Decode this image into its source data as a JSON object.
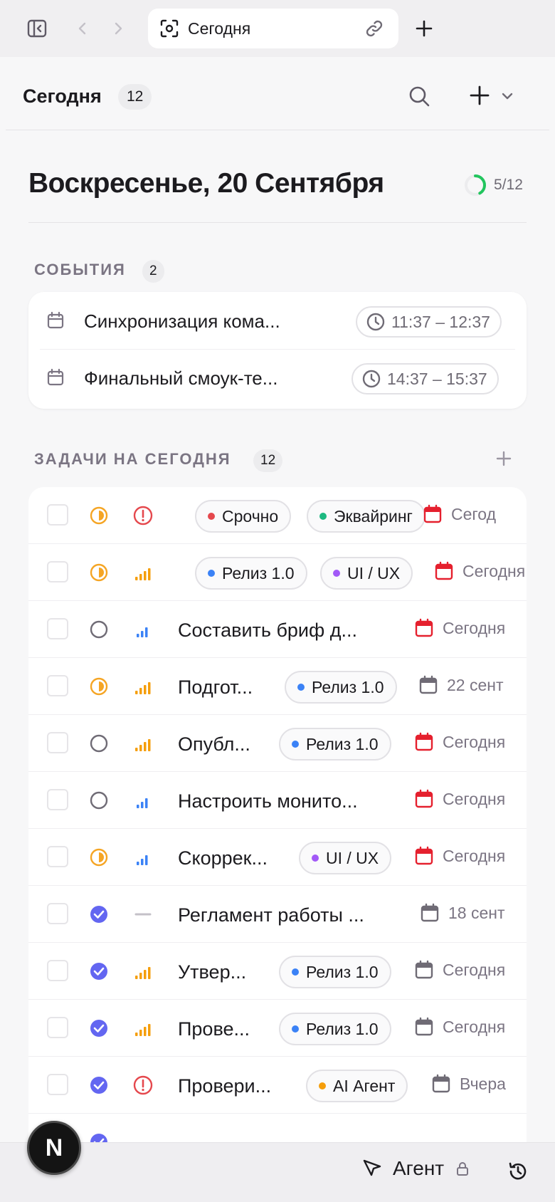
{
  "browser": {
    "tab_title": "Сегодня",
    "icons": [
      "sidebar-toggle-icon",
      "back-icon",
      "forward-icon",
      "focus-icon",
      "link-icon",
      "new-tab-icon"
    ]
  },
  "header": {
    "title": "Сегодня",
    "count": "12"
  },
  "date_heading": "Воскресенье, 20 Сентября",
  "progress": {
    "text": "5/12",
    "done": 5,
    "total": 12,
    "color": "#22c55e"
  },
  "events_section": {
    "label": "СОБЫТИЯ",
    "count": "2",
    "items": [
      {
        "title": "Синхронизация кома...",
        "time": "11:37 – 12:37"
      },
      {
        "title": "Финальный смоук-те...",
        "time": "14:37 – 15:37"
      }
    ]
  },
  "tasks_section": {
    "label": "ЗАДАЧИ НА СЕГОДНЯ",
    "count": "12",
    "items": [
      {
        "title": "",
        "status": "in-progress",
        "priority": "urgent",
        "tags": [
          {
            "label": "Срочно",
            "color": "#e5484d"
          },
          {
            "label": "Эквайринг",
            "color": "#1db981"
          }
        ],
        "due": "Сегод",
        "due_red": true
      },
      {
        "title": "",
        "status": "in-progress",
        "priority": "high",
        "tags": [
          {
            "label": "Релиз 1.0",
            "color": "#3b82f6"
          },
          {
            "label": "UI / UX",
            "color": "#a259f7"
          }
        ],
        "due": "Сегодня",
        "due_red": true
      },
      {
        "title": "Составить бриф д...",
        "status": "todo",
        "priority": "low",
        "tags": [],
        "due": "Сегодня",
        "due_red": true
      },
      {
        "title": "Подгот...",
        "status": "in-progress",
        "priority": "high",
        "tags": [
          {
            "label": "Релиз 1.0",
            "color": "#3b82f6"
          }
        ],
        "due": "22 сент",
        "due_red": false
      },
      {
        "title": "Опубл...",
        "status": "todo",
        "priority": "high",
        "tags": [
          {
            "label": "Релиз 1.0",
            "color": "#3b82f6"
          }
        ],
        "due": "Сегодня",
        "due_red": true
      },
      {
        "title": "Настроить монито...",
        "status": "todo",
        "priority": "low",
        "tags": [],
        "due": "Сегодня",
        "due_red": true
      },
      {
        "title": "Скоррек...",
        "status": "in-progress",
        "priority": "low",
        "tags": [
          {
            "label": "UI / UX",
            "color": "#a259f7"
          }
        ],
        "due": "Сегодня",
        "due_red": true
      },
      {
        "title": "Регламент работы ...",
        "status": "done",
        "priority": "none",
        "tags": [],
        "due": "18 сент",
        "due_red": false
      },
      {
        "title": "Утвер...",
        "status": "done",
        "priority": "high",
        "tags": [
          {
            "label": "Релиз 1.0",
            "color": "#3b82f6"
          }
        ],
        "due": "Сегодня",
        "due_red": false
      },
      {
        "title": "Прове...",
        "status": "done",
        "priority": "high",
        "tags": [
          {
            "label": "Релиз 1.0",
            "color": "#3b82f6"
          }
        ],
        "due": "Сегодня",
        "due_red": false
      },
      {
        "title": "Провери...",
        "status": "done",
        "priority": "urgent",
        "tags": [
          {
            "label": "AI Агент",
            "color": "#f59e0b"
          }
        ],
        "due": "Вчера",
        "due_red": false
      }
    ]
  },
  "bottom": {
    "agent_label": "Агент",
    "fab_letter": "N"
  }
}
